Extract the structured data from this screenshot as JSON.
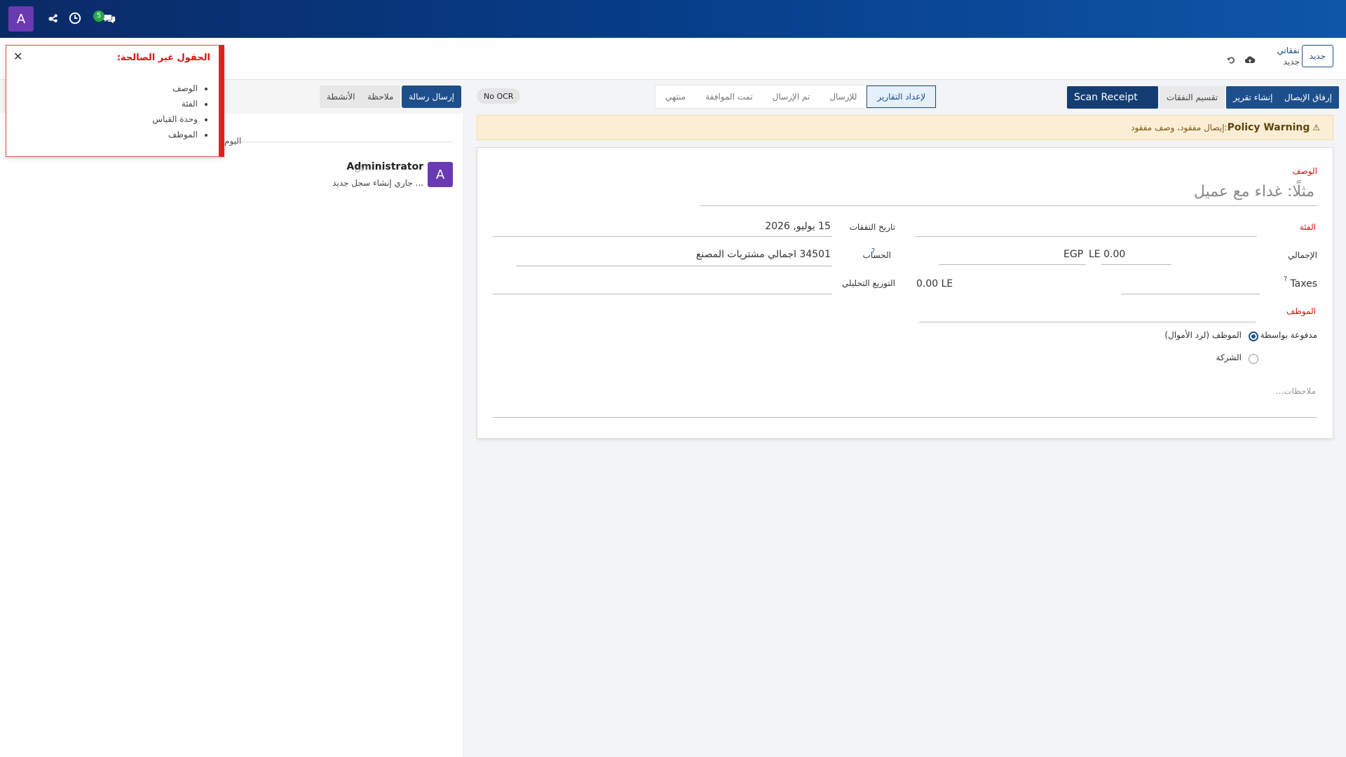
{
  "topbar": {
    "avatar_letter": "A",
    "messages_badge": "5"
  },
  "control": {
    "new_button": "جديد",
    "breadcrumb_parent": "نفقاتي",
    "breadcrumb_current": "جديد"
  },
  "statusbar": {
    "attach_receipt": "إرفاق الإيصال",
    "create_report": "إنشاء تقرير",
    "split_expense": "تقسيم النفقات",
    "scan_receipt": "Scan Receipt",
    "ocr_badge": "No OCR",
    "steps": [
      "لإعداد التقارير",
      "للإرسال",
      "تم الإرسال",
      "تمت الموافقة",
      "منتهي"
    ]
  },
  "policy": {
    "title": "Policy Warning",
    "text": ":إيصال مفقود، وصف مفقود"
  },
  "form": {
    "description_label": "الوصف",
    "description_placeholder": "مثلًا: غداء مع عميل",
    "category_label": "الفئة",
    "category_value": "",
    "expense_date_label": "تاريخ النفقات",
    "expense_date_value": "15 يوليو, 2026",
    "total_label": "الإجمالي",
    "total_value": "LE 0.00",
    "currency_value": "EGP",
    "account_label": "الحساب",
    "account_value": "34501 اجمالي مشتريات المصنع",
    "taxes_label": "Taxes",
    "taxes_amount": "0.00 LE",
    "analytic_label": "التوزيع التحليلي",
    "employee_label": "الموظف",
    "paid_by_label": "مدفوعة بواسطة",
    "paid_by_employee": "الموظف (لرد الأموال)",
    "paid_by_company": "الشركة",
    "notes_placeholder": "ملاحظات..."
  },
  "chatter": {
    "send_message": "إرسال رسالة",
    "log_note": "ملاحظة",
    "activities": "الأنشطة",
    "today": "اليوم",
    "message_author": "Administrator",
    "message_time": "- الآن",
    "message_body": "جاري إنشاء سجل جديد ..."
  },
  "invalid_popup": {
    "title": "الحقول غير الصالحة:",
    "fields": [
      "الوصف",
      "الفئة",
      "وحدة القياس",
      "الموظف"
    ]
  },
  "colors": {
    "navbar": "#073e8a",
    "primary": "#1d4f8c",
    "required": "#dd1111",
    "avatar": "#6a3ab2",
    "badge": "#27a745"
  }
}
